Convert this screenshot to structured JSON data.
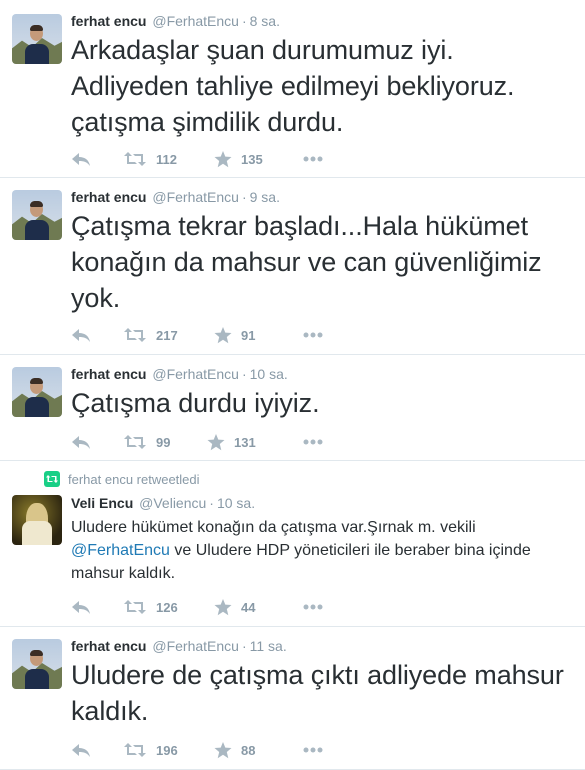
{
  "colors": {
    "text": "#292f33",
    "muted": "#8899a6",
    "icon": "#aab8c2",
    "link": "#1f7ab5",
    "retweet_green": "#19cf86",
    "divider": "#e1e8ed"
  },
  "tweets": [
    {
      "name": "ferhat encu",
      "handle": "@FerhatEncu",
      "sep": "·",
      "time": "8 sa.",
      "text": "Arkadaşlar şuan durumumuz iyi. Adliyeden tahliye edilmeyi bekliyoruz. çatışma şimdilik durdu.",
      "retweets": "112",
      "favorites": "135"
    },
    {
      "name": "ferhat encu",
      "handle": "@FerhatEncu",
      "sep": "·",
      "time": "9 sa.",
      "text": "Çatışma tekrar başladı...Hala hükümet konağın da mahsur ve can güvenliğimiz yok.",
      "retweets": "217",
      "favorites": "91"
    },
    {
      "name": "ferhat encu",
      "handle": "@FerhatEncu",
      "sep": "·",
      "time": "10 sa.",
      "text": "Çatışma durdu iyiyiz.",
      "retweets": "99",
      "favorites": "131"
    },
    {
      "retweet_context": "ferhat encu retweetledi",
      "name": "Veli Encu",
      "handle": "@Velіencu",
      "sep": "·",
      "time": "10 sa.",
      "text_part1": "Uludere hükümet konağın da çatışma var.Şırnak m. vekili ",
      "mention": "@FerhatEncu",
      "text_part2": " ve Uludere HDP yöneticileri ile beraber bina içinde mahsur kaldık.",
      "retweets": "126",
      "favorites": "44"
    },
    {
      "name": "ferhat encu",
      "handle": "@FerhatEncu",
      "sep": "·",
      "time": "11 sa.",
      "text": "Uludere de çatışma çıktı adliyede mahsur kaldık.",
      "retweets": "196",
      "favorites": "88"
    }
  ]
}
